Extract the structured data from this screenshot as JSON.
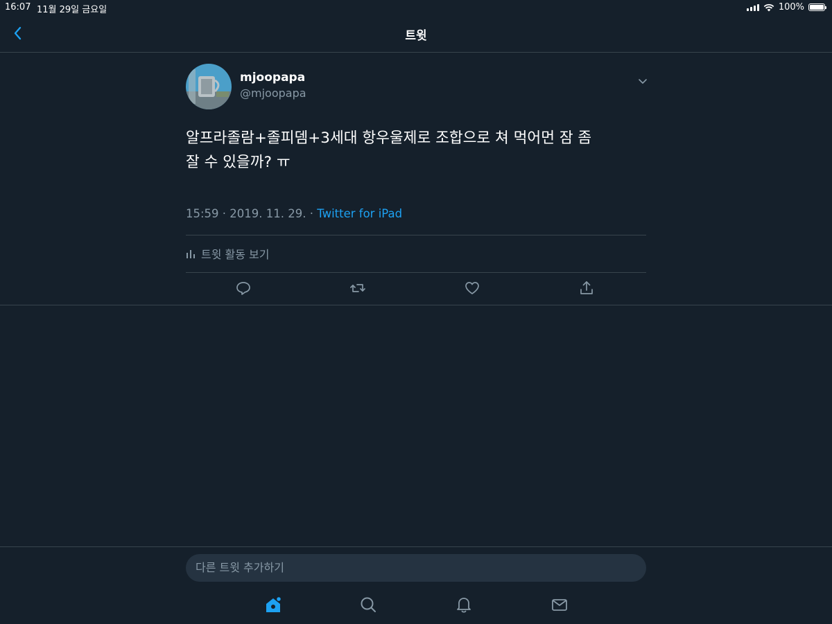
{
  "status_bar": {
    "time": "16:07",
    "date": "11월 29일 금요일",
    "battery": "100%",
    "battery_level": 1.0
  },
  "nav": {
    "title": "트윗",
    "back_icon": "chevron-left-icon"
  },
  "tweet": {
    "display_name": "mjoopapa",
    "handle": "@mjoopapa",
    "text_line1": "알프라졸람+졸피뎀+3세대 항우울제로 조합으로 쳐 먹어먼 잠 좀",
    "text_line2": "잘 수 있을까? ㅠ",
    "timestamp": "15:59 · 2019. 11. 29. · ",
    "source": "Twitter for iPad",
    "activity_label": "트윗 활동 보기",
    "actions": [
      "reply-icon",
      "retweet-icon",
      "like-icon",
      "share-icon"
    ]
  },
  "reply": {
    "placeholder": "다른 트윗 추가하기"
  },
  "tabs": [
    "home-icon",
    "search-icon",
    "notifications-icon",
    "messages-icon"
  ],
  "colors": {
    "background": "#15202b",
    "accent": "#1da1f2",
    "secondary_text": "#8899a6",
    "divider": "#38444d"
  }
}
